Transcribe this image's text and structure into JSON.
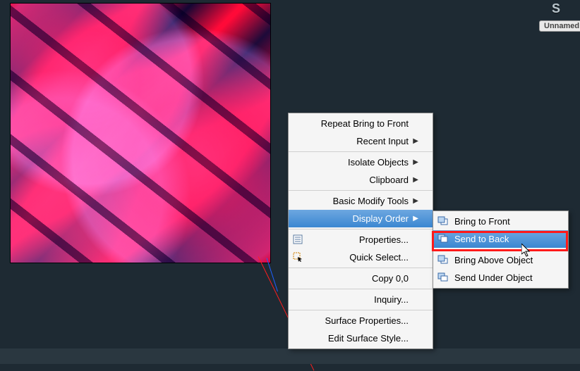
{
  "viewcube": {
    "letter": "S",
    "label": "Unnamed"
  },
  "context_menu": {
    "groups": [
      {
        "items": [
          {
            "label": "Repeat Bring to Front",
            "submenu": false
          },
          {
            "label": "Recent Input",
            "submenu": true
          }
        ]
      },
      {
        "items": [
          {
            "label": "Isolate Objects",
            "submenu": true
          },
          {
            "label": "Clipboard",
            "submenu": true
          }
        ]
      },
      {
        "items": [
          {
            "label": "Basic Modify Tools",
            "submenu": true
          },
          {
            "label": "Display Order",
            "submenu": true,
            "highlighted": true
          }
        ]
      },
      {
        "items": [
          {
            "label": "Properties...",
            "icon": "properties-icon"
          },
          {
            "label": "Quick Select...",
            "icon": "quick-select-icon"
          }
        ]
      },
      {
        "items": [
          {
            "label": "Copy 0,0"
          }
        ]
      },
      {
        "items": [
          {
            "label": "Inquiry..."
          }
        ]
      },
      {
        "items": [
          {
            "label": "Surface Properties..."
          },
          {
            "label": "Edit Surface Style..."
          }
        ]
      }
    ]
  },
  "display_order_submenu": {
    "groups": [
      {
        "items": [
          {
            "label": "Bring to Front",
            "icon": "bring-front-icon"
          },
          {
            "label": "Send to Back",
            "icon": "send-back-icon",
            "highlighted": true
          }
        ]
      },
      {
        "items": [
          {
            "label": "Bring Above Object",
            "icon": "bring-above-icon"
          },
          {
            "label": "Send Under Object",
            "icon": "send-under-icon"
          }
        ]
      }
    ]
  }
}
